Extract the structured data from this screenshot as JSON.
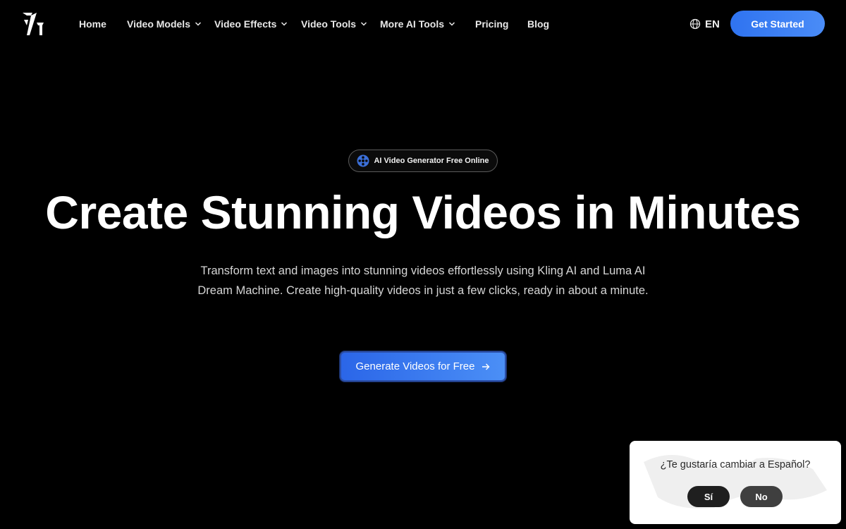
{
  "header": {
    "nav": [
      {
        "label": "Home",
        "dropdown": false
      },
      {
        "label": "Video Models",
        "dropdown": true
      },
      {
        "label": "Video Effects",
        "dropdown": true
      },
      {
        "label": "Video Tools",
        "dropdown": true
      },
      {
        "label": "More AI Tools",
        "dropdown": true
      },
      {
        "label": "Pricing",
        "dropdown": false
      },
      {
        "label": "Blog",
        "dropdown": false
      }
    ],
    "language": "EN",
    "get_started_label": "Get Started"
  },
  "hero": {
    "badge_label": "AI Video Generator Free Online",
    "title": "Create Stunning Videos in Minutes",
    "subtitle": "Transform text and images into stunning videos effortlessly using Kling AI and Luma AI Dream Machine. Create high-quality videos in just a few clicks, ready in about a minute.",
    "cta_label": "Generate Videos for Free"
  },
  "language_popup": {
    "question": "¿Te gustaría cambiar a Español?",
    "yes_label": "Sí",
    "no_label": "No"
  },
  "icons": {
    "logo": "brand-logo-icon",
    "chevron": "chevron-down-icon",
    "globe": "globe-icon",
    "badge": "film-reel-icon",
    "arrow": "arrow-right-icon"
  },
  "colors": {
    "background": "#000000",
    "accent_blue": "#3b82f6",
    "popup_bg": "#ffffff",
    "popup_btn_dark": "#1f1f1f"
  }
}
